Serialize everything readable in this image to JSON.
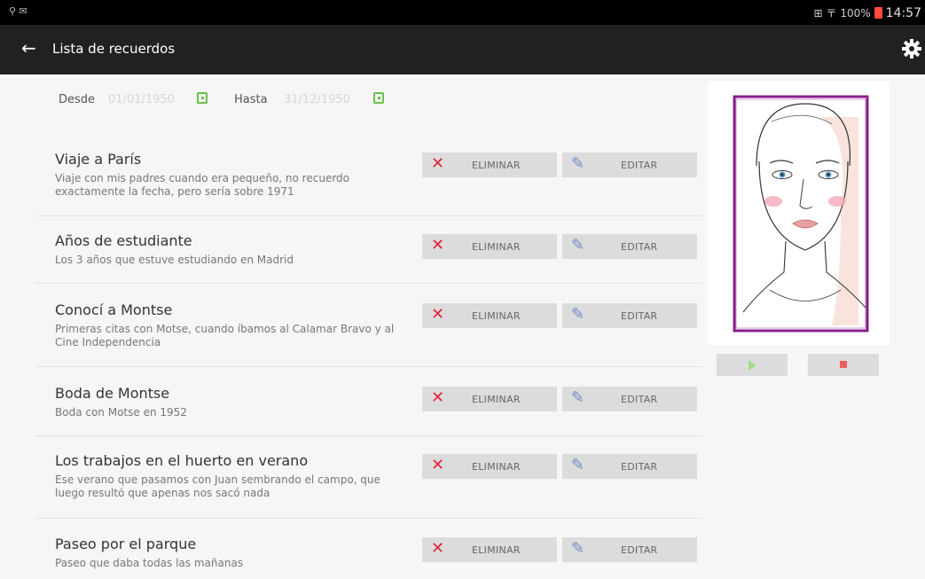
{
  "status_bar": {
    "left_icons": "⚲ ✉",
    "signal_text": "⊞ 〒",
    "battery_text": "100%",
    "clock": "14:57"
  },
  "action_bar": {
    "back_icon": "arrow-left-icon",
    "title": "Lista de recuerdos",
    "settings_icon": "gear-icon"
  },
  "filter": {
    "from_label": "Desde",
    "from_value": "01/01/1950",
    "to_label": "Hasta",
    "to_value": "31/12/1950"
  },
  "buttons": {
    "delete_label": "ELIMINAR",
    "edit_label": "EDITAR"
  },
  "memories": [
    {
      "title": "Viaje a París",
      "description": "Viaje con mis padres cuando era pequeño, no recuerdo exactamente la fecha, pero sería sobre 1971"
    },
    {
      "title": "Años de estudiante",
      "description": "Los 3 años que estuve estudiando en Madrid"
    },
    {
      "title": "Conocí a Montse",
      "description": "Primeras citas con Motse, cuando íbamos al Calamar Bravo y al Cine Independencia"
    },
    {
      "title": "Boda de Montse",
      "description": "Boda con Motse en 1952"
    },
    {
      "title": "Los trabajos en el huerto en verano",
      "description": "Ese verano que pasamos con Juan sembrando el campo, que luego resultó que apenas nos sacó nada"
    },
    {
      "title": "Paseo por el parque",
      "description": "Paseo que daba todas las mañanas"
    }
  ],
  "colors": {
    "action_bar": "#212121",
    "delete_icon": "#e0253a",
    "edit_icon": "#6d8fc5",
    "calendar_icon": "#6abf4b",
    "play_icon": "#9fdc8c",
    "stop_icon": "#ef5b5b",
    "face_frame": "#8a1f8a"
  }
}
